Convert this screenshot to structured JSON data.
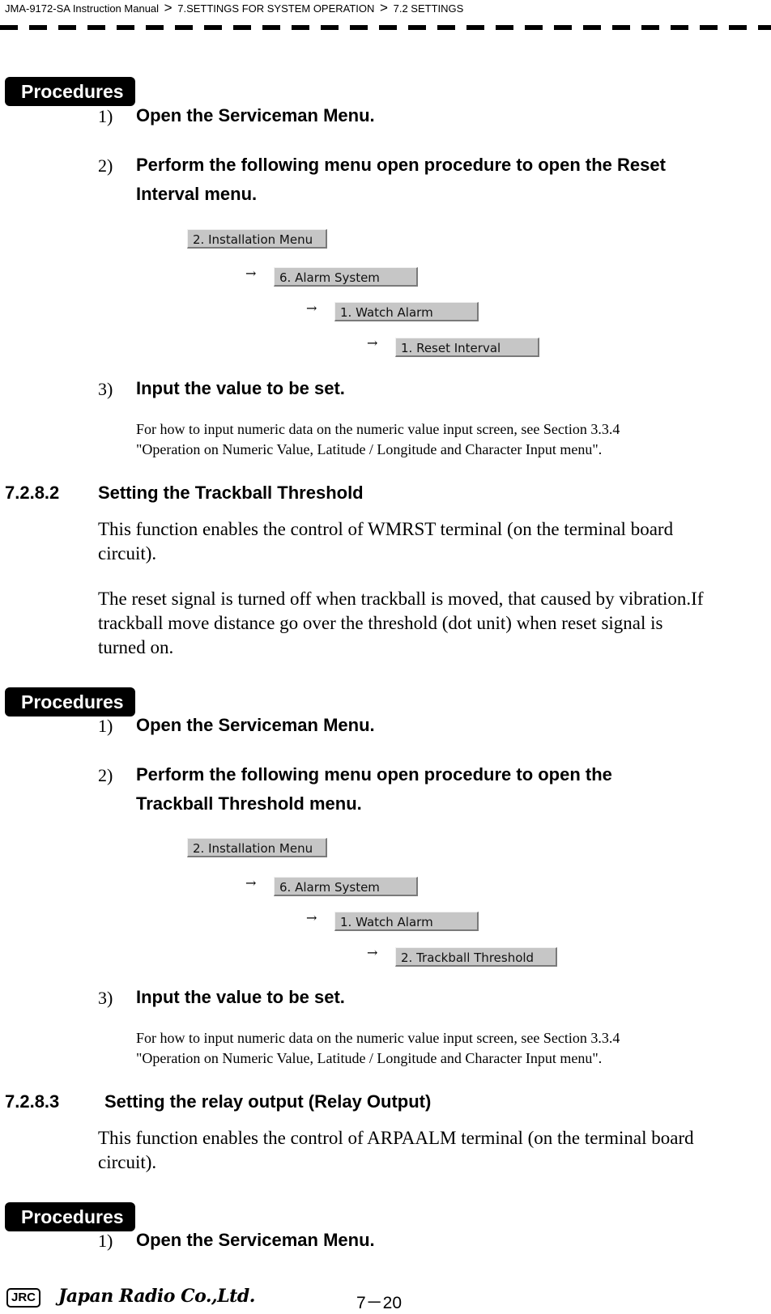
{
  "header": {
    "manual": "JMA-9172-SA Instruction Manual",
    "separator": ">",
    "chapter": "7.SETTINGS FOR SYSTEM OPERATION",
    "section": "7.2  SETTINGS"
  },
  "blocks": [
    {
      "badge": "Procedures",
      "steps": [
        {
          "num": "1)",
          "text": "Open the Serviceman Menu."
        },
        {
          "num": "2)",
          "text_line1": "Perform the following menu open procedure to open the Reset",
          "text_line2": "Interval menu."
        },
        {
          "num": "3)",
          "text": "Input the value to be set."
        }
      ],
      "menu_path": [
        "2. Installation Menu",
        "6. Alarm System",
        "1. Watch Alarm",
        "1. Reset Interval"
      ],
      "note_line1": "For how to input numeric data on the numeric value input screen, see Section 3.3.4",
      "note_line2": "\"Operation on Numeric Value, Latitude / Longitude and Character Input menu\"."
    },
    {
      "section_num": "7.2.8.2",
      "section_title": "Setting the Trackball Threshold",
      "para1_line1": "This function enables the control of WMRST terminal (on the terminal board",
      "para1_line2": "circuit).",
      "para2_line1": "The reset signal is turned off when trackball is moved, that caused by vibration.If",
      "para2_line2": "trackball move distance go over the threshold (dot unit) when reset signal is",
      "para2_line3": "turned on.",
      "badge": "Procedures",
      "steps": [
        {
          "num": "1)",
          "text": "Open the Serviceman Menu."
        },
        {
          "num": "2)",
          "text_line1": "Perform the following menu open procedure to open the",
          "text_line2": "Trackball Threshold menu."
        },
        {
          "num": "3)",
          "text": "Input the value to be set."
        }
      ],
      "menu_path": [
        "2. Installation Menu",
        "6. Alarm System",
        "1. Watch Alarm",
        "2. Trackball Threshold"
      ],
      "note_line1": "For how to input numeric data on the numeric value input screen, see Section 3.3.4",
      "note_line2": "\"Operation on Numeric Value, Latitude / Longitude and Character Input menu\"."
    },
    {
      "section_num": "7.2.8.3",
      "section_title": "Setting the relay output (Relay Output)",
      "para1_line1": "This function enables the control of ARPAALM terminal (on the terminal board",
      "para1_line2": "circuit).",
      "badge": "Procedures",
      "steps": [
        {
          "num": "1)",
          "text": "Open the Serviceman Menu."
        }
      ]
    }
  ],
  "arrow_glyph": "→",
  "footer": {
    "logo": "JRC",
    "company": "Japan Radio Co.,Ltd.",
    "page": "7－20"
  }
}
